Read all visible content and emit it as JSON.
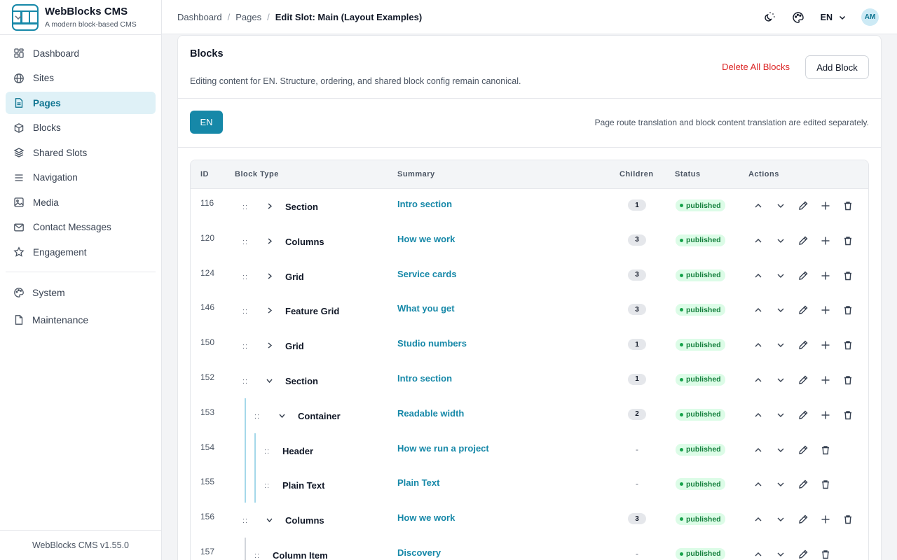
{
  "app": {
    "name": "WebBlocks CMS",
    "tagline": "A modern block-based CMS",
    "version": "WebBlocks CMS v1.55.0"
  },
  "sidebar": {
    "items": [
      {
        "label": "Dashboard",
        "icon": "dashboard-icon"
      },
      {
        "label": "Sites",
        "icon": "globe-icon"
      },
      {
        "label": "Pages",
        "icon": "document-icon",
        "active": true
      },
      {
        "label": "Blocks",
        "icon": "cube-icon"
      },
      {
        "label": "Shared Slots",
        "icon": "layers-icon"
      },
      {
        "label": "Navigation",
        "icon": "menu-icon"
      },
      {
        "label": "Media",
        "icon": "image-icon"
      },
      {
        "label": "Contact Messages",
        "icon": "mail-icon"
      },
      {
        "label": "Engagement",
        "icon": "star-icon"
      }
    ],
    "groups": [
      {
        "label": "System",
        "icon": "palette-icon"
      },
      {
        "label": "Maintenance",
        "icon": "file-icon"
      }
    ]
  },
  "topbar": {
    "breadcrumb": [
      "Dashboard",
      "Pages",
      "Edit Slot: Main (Layout Examples)"
    ],
    "language": "EN",
    "avatar": "AM"
  },
  "blocks": {
    "title": "Blocks",
    "description": "Editing content for EN. Structure, ordering, and shared block config remain canonical.",
    "delete_all_label": "Delete All Blocks",
    "add_label": "Add Block",
    "lang_pill": "EN",
    "lang_note": "Page route translation and block content translation are edited separately."
  },
  "table": {
    "headers": {
      "id": "ID",
      "type": "Block Type",
      "summary": "Summary",
      "children": "Children",
      "status": "Status",
      "actions": "Actions"
    },
    "rows": [
      {
        "id": "116",
        "type": "Section",
        "summary": "Intro section",
        "children": "1",
        "status": "published",
        "level": 0,
        "expand": "collapsed"
      },
      {
        "id": "120",
        "type": "Columns",
        "summary": "How we work",
        "children": "3",
        "status": "published",
        "level": 0,
        "expand": "collapsed"
      },
      {
        "id": "124",
        "type": "Grid",
        "summary": "Service cards",
        "children": "3",
        "status": "published",
        "level": 0,
        "expand": "collapsed"
      },
      {
        "id": "146",
        "type": "Feature Grid",
        "summary": "What you get",
        "children": "3",
        "status": "published",
        "level": 0,
        "expand": "collapsed"
      },
      {
        "id": "150",
        "type": "Grid",
        "summary": "Studio numbers",
        "children": "1",
        "status": "published",
        "level": 0,
        "expand": "collapsed"
      },
      {
        "id": "152",
        "type": "Section",
        "summary": "Intro section",
        "children": "1",
        "status": "published",
        "level": 0,
        "expand": "expanded"
      },
      {
        "id": "153",
        "type": "Container",
        "summary": "Readable width",
        "children": "2",
        "status": "published",
        "level": 1,
        "expand": "expanded"
      },
      {
        "id": "154",
        "type": "Header",
        "summary": "How we run a project",
        "children": "-",
        "status": "published",
        "level": 2,
        "expand": "none"
      },
      {
        "id": "155",
        "type": "Plain Text",
        "summary": "Plain Text",
        "children": "-",
        "status": "published",
        "level": 2,
        "expand": "none"
      },
      {
        "id": "156",
        "type": "Columns",
        "summary": "How we work",
        "children": "3",
        "status": "published",
        "level": 0,
        "expand": "expanded"
      },
      {
        "id": "157",
        "type": "Column Item",
        "summary": "Discovery",
        "children": "-",
        "status": "published",
        "level": 1,
        "expand": "none"
      }
    ]
  }
}
